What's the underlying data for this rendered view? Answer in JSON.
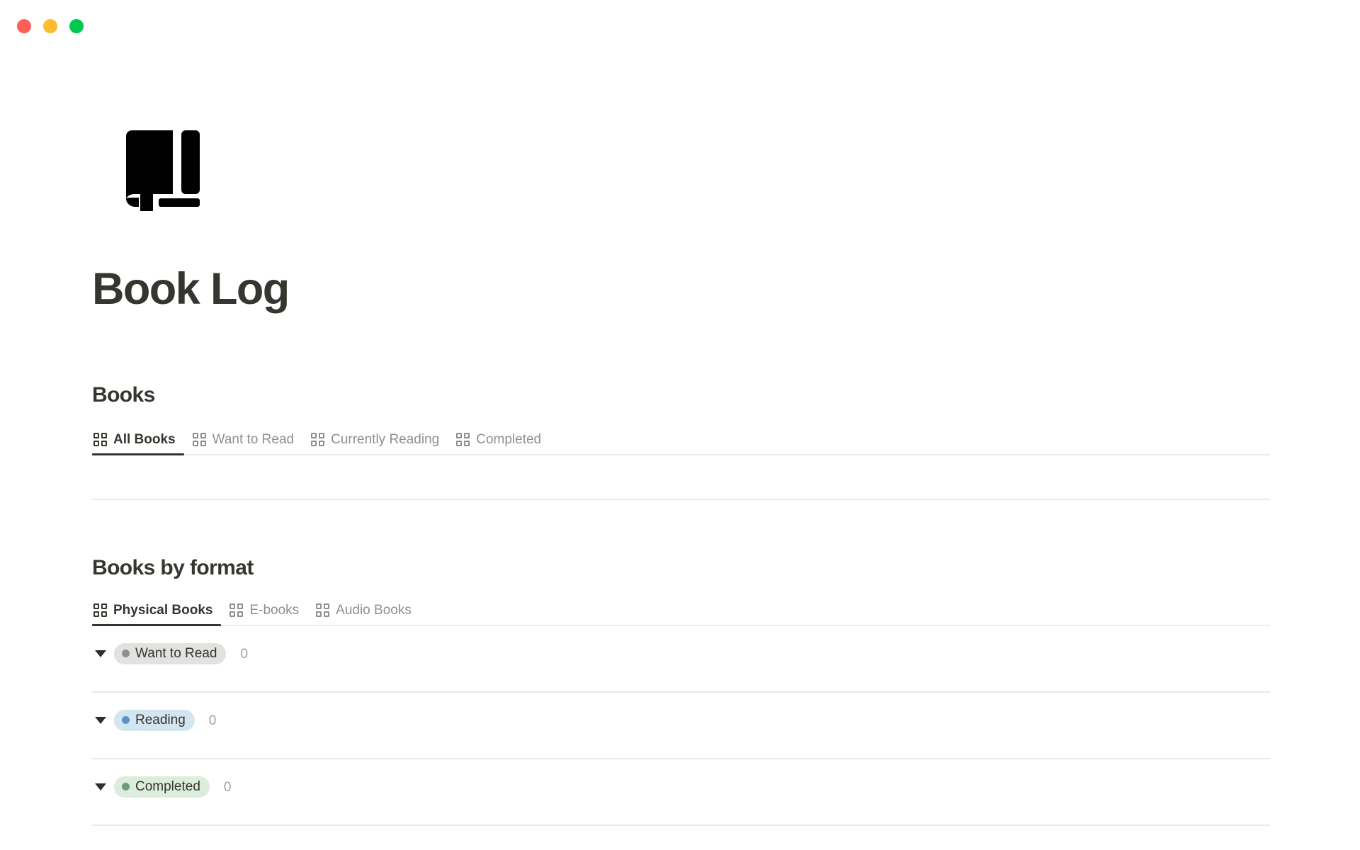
{
  "window": {
    "traffic_lights": [
      {
        "name": "close-button",
        "color": "#ff5f57"
      },
      {
        "name": "minimize-button",
        "color": "#febc2e"
      },
      {
        "name": "maximize-button",
        "color": "#00ca4e"
      }
    ]
  },
  "page": {
    "icon": "notebook-icon",
    "title": "Book Log"
  },
  "sections": [
    {
      "heading": "Books",
      "tabs": [
        {
          "label": "All Books",
          "icon": "gallery-grid-icon",
          "active": true
        },
        {
          "label": "Want to Read",
          "icon": "gallery-grid-icon",
          "active": false
        },
        {
          "label": "Currently Reading",
          "icon": "gallery-grid-icon",
          "active": false
        },
        {
          "label": "Completed",
          "icon": "gallery-grid-icon",
          "active": false
        }
      ]
    },
    {
      "heading": "Books by format",
      "tabs": [
        {
          "label": "Physical Books",
          "icon": "gallery-grid-icon",
          "active": true
        },
        {
          "label": "E-books",
          "icon": "gallery-grid-icon",
          "active": false
        },
        {
          "label": "Audio Books",
          "icon": "gallery-grid-icon",
          "active": false
        }
      ],
      "groups": [
        {
          "label": "Want to Read",
          "count": "0",
          "pill_bg": "#e3e2e0",
          "dot_color": "#908e8a"
        },
        {
          "label": "Reading",
          "count": "0",
          "pill_bg": "#d3e5ef",
          "dot_color": "#5b93c4"
        },
        {
          "label": "Completed",
          "count": "0",
          "pill_bg": "#dbeddb",
          "dot_color": "#6c9b7d"
        }
      ]
    }
  ],
  "colors": {
    "text_primary": "#37352f",
    "text_muted": "#918f8b",
    "divider": "#e9e9e7",
    "background": "#ffffff"
  }
}
